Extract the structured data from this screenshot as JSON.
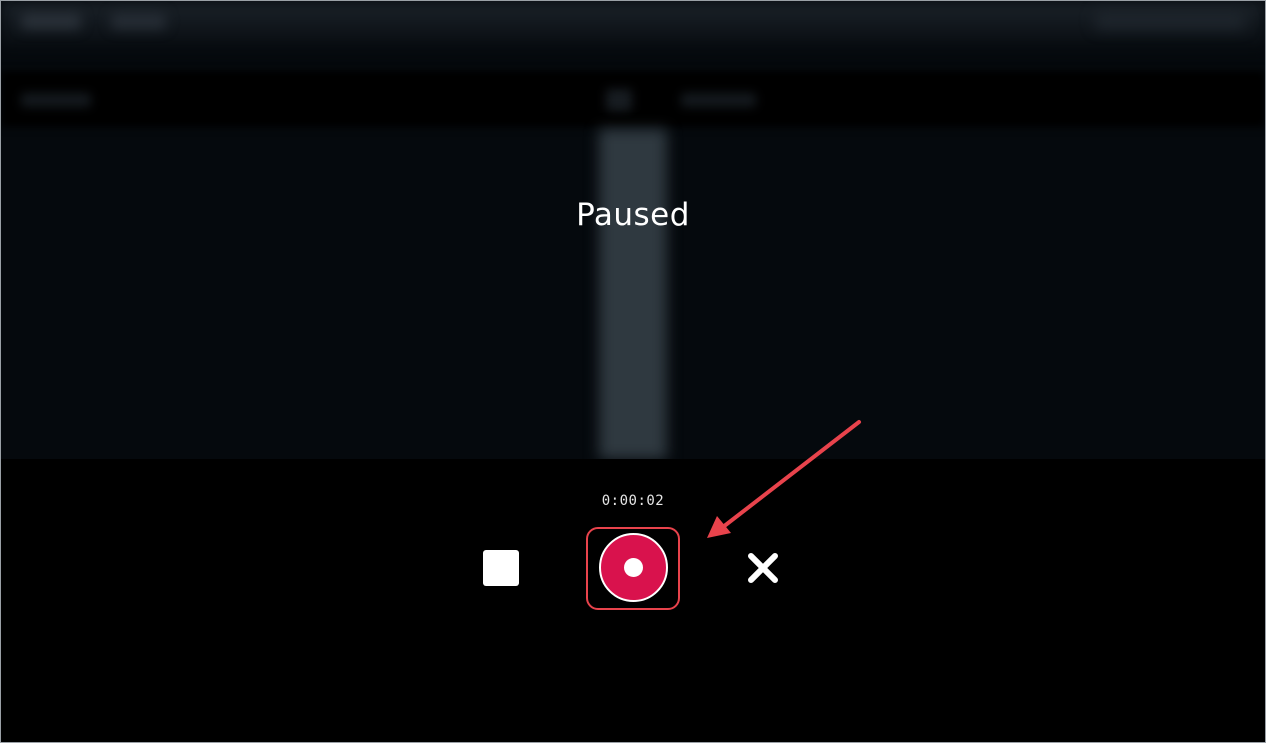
{
  "status": {
    "label": "Paused"
  },
  "recorder": {
    "elapsed_time": "0:00:02",
    "stop_icon": "stop-icon",
    "record_icon": "record-icon",
    "close_icon": "close-icon"
  },
  "colors": {
    "background": "#000000",
    "record_fill": "#d9124d",
    "highlight": "#e8434c",
    "text": "#ffffff"
  }
}
